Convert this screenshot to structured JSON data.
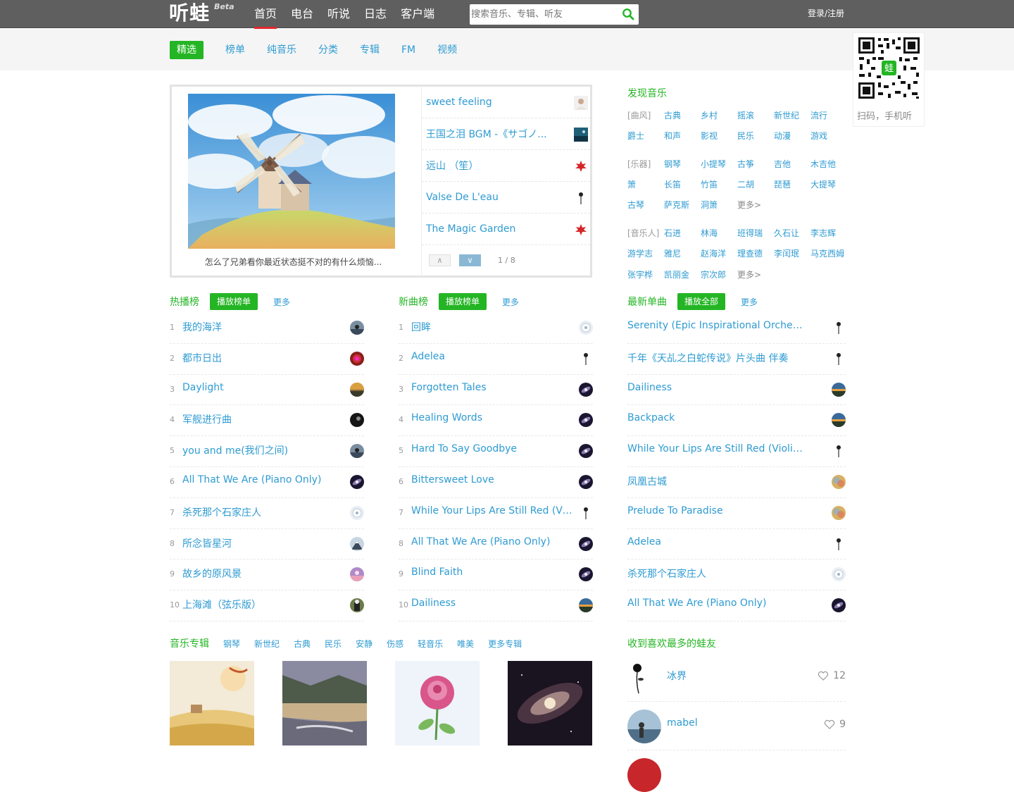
{
  "header": {
    "logo": "听蛙",
    "beta": "Beta",
    "nav": [
      {
        "label": "首页",
        "active": true
      },
      {
        "label": "电台",
        "active": false
      },
      {
        "label": "听说",
        "active": false
      },
      {
        "label": "日志",
        "active": false
      },
      {
        "label": "客户端",
        "active": false
      }
    ],
    "search_placeholder": "搜索音乐、专辑、听友",
    "login": "登录/注册"
  },
  "subnav": [
    {
      "label": "精选",
      "active": true
    },
    {
      "label": "榜单",
      "active": false
    },
    {
      "label": "纯音乐",
      "active": false
    },
    {
      "label": "分类",
      "active": false
    },
    {
      "label": "专辑",
      "active": false
    },
    {
      "label": "FM",
      "active": false
    },
    {
      "label": "视频",
      "active": false
    }
  ],
  "qr": {
    "badge": "蛙",
    "caption": "扫码，手机听"
  },
  "featured": {
    "caption": "怎么了兄弟看你最近状态挺不对的有什么烦恼...",
    "items": [
      {
        "title": "sweet feeling",
        "thumb": "portrait"
      },
      {
        "title": "王国之泪 BGM -《サゴノ...",
        "thumb": "blue"
      },
      {
        "title": "远山 （笙）",
        "thumb": "red"
      },
      {
        "title": "Valse De L'eau",
        "thumb": "rose"
      },
      {
        "title": "The Magic Garden",
        "thumb": "red"
      }
    ],
    "pager_prev": "∧",
    "pager_next": "∨",
    "pager_count": "1 / 8"
  },
  "discover": {
    "title": "发现音乐",
    "more": "更多>",
    "genre": {
      "label": "[曲风]",
      "row1": [
        "古典",
        "乡村",
        "摇滚",
        "新世纪",
        "流行"
      ],
      "row2": [
        "爵士",
        "和声",
        "影视",
        "民乐",
        "动漫",
        "游戏"
      ]
    },
    "instrument": {
      "label": "[乐器]",
      "row1": [
        "钢琴",
        "小提琴",
        "古筝",
        "吉他",
        "木吉他"
      ],
      "row2": [
        "箫",
        "长笛",
        "竹笛",
        "二胡",
        "琵琶",
        "大提琴"
      ],
      "row3": [
        "古琴",
        "萨克斯",
        "洞箫"
      ]
    },
    "artist": {
      "label": "[音乐人]",
      "row1": [
        "石进",
        "林海",
        "班得瑞",
        "久石让",
        "李志辉"
      ],
      "row2": [
        "游学志",
        "雅尼",
        "赵海洋",
        "理查德",
        "李闰珉",
        "马克西姆"
      ],
      "row3": [
        "张宇桦",
        "凯丽金",
        "宗次郎"
      ]
    }
  },
  "hot": {
    "title": "热播榜",
    "play": "播放榜单",
    "more": "更多",
    "items": [
      {
        "num": "1",
        "title": "我的海洋",
        "thumb": "sky"
      },
      {
        "num": "2",
        "title": "都市日出",
        "thumb": "crimson"
      },
      {
        "num": "3",
        "title": "Daylight",
        "thumb": "sunset"
      },
      {
        "num": "4",
        "title": "军舰进行曲",
        "thumb": "dark"
      },
      {
        "num": "5",
        "title": "you and me(我们之间)",
        "thumb": "sky"
      },
      {
        "num": "6",
        "title": "All That We Are (Piano Only)",
        "thumb": "galaxy"
      },
      {
        "num": "7",
        "title": "杀死那个石家庄人",
        "thumb": "flower"
      },
      {
        "num": "8",
        "title": "所念皆星河",
        "thumb": "mountain"
      },
      {
        "num": "9",
        "title": "故乡的原风景",
        "thumb": "purple"
      },
      {
        "num": "10",
        "title": "上海滩（弦乐版）",
        "thumb": "olive"
      }
    ]
  },
  "new_songs": {
    "title": "新曲榜",
    "play": "播放榜单",
    "more": "更多",
    "items": [
      {
        "num": "1",
        "title": "回眸",
        "thumb": "flower"
      },
      {
        "num": "2",
        "title": "Adelea",
        "thumb": "rose"
      },
      {
        "num": "3",
        "title": "Forgotten Tales",
        "thumb": "galaxy"
      },
      {
        "num": "4",
        "title": "Healing Words",
        "thumb": "galaxy"
      },
      {
        "num": "5",
        "title": "Hard To Say Goodbye",
        "thumb": "galaxy"
      },
      {
        "num": "6",
        "title": "Bittersweet Love",
        "thumb": "galaxy"
      },
      {
        "num": "7",
        "title": "While Your Lips Are Still Red (Violi...",
        "thumb": "rose"
      },
      {
        "num": "8",
        "title": "All That We Are (Piano Only)",
        "thumb": "galaxy"
      },
      {
        "num": "9",
        "title": "Blind Faith",
        "thumb": "galaxy"
      },
      {
        "num": "10",
        "title": "Dailiness",
        "thumb": "horizon"
      }
    ]
  },
  "latest": {
    "title": "最新单曲",
    "play": "播放全部",
    "more": "更多",
    "items": [
      {
        "title": "Serenity (Epic Inspirational Orchestral...",
        "thumb": "rose"
      },
      {
        "title": "千年《天乩之白蛇传说》片头曲 伴奏",
        "thumb": "rose"
      },
      {
        "title": "Dailiness",
        "thumb": "horizon"
      },
      {
        "title": "Backpack",
        "thumb": "horizon"
      },
      {
        "title": "While Your Lips Are Still Red (Violin V...",
        "thumb": "rose"
      },
      {
        "title": "凤凰古城",
        "thumb": "gold"
      },
      {
        "title": "Prelude To Paradise",
        "thumb": "gold"
      },
      {
        "title": "Adelea",
        "thumb": "rose"
      },
      {
        "title": "杀死那个石家庄人",
        "thumb": "flower"
      },
      {
        "title": "All That We Are (Piano Only)",
        "thumb": "galaxy"
      }
    ]
  },
  "albums": {
    "title": "音乐专辑",
    "tags": [
      "钢琴",
      "新世纪",
      "古典",
      "民乐",
      "安静",
      "伤感",
      "轻音乐",
      "唯美",
      "更多专辑"
    ]
  },
  "fans": {
    "title": "收到喜欢最多的蛙友",
    "items": [
      {
        "name": "冰界",
        "likes": "12"
      },
      {
        "name": "mabel",
        "likes": "9"
      }
    ]
  }
}
